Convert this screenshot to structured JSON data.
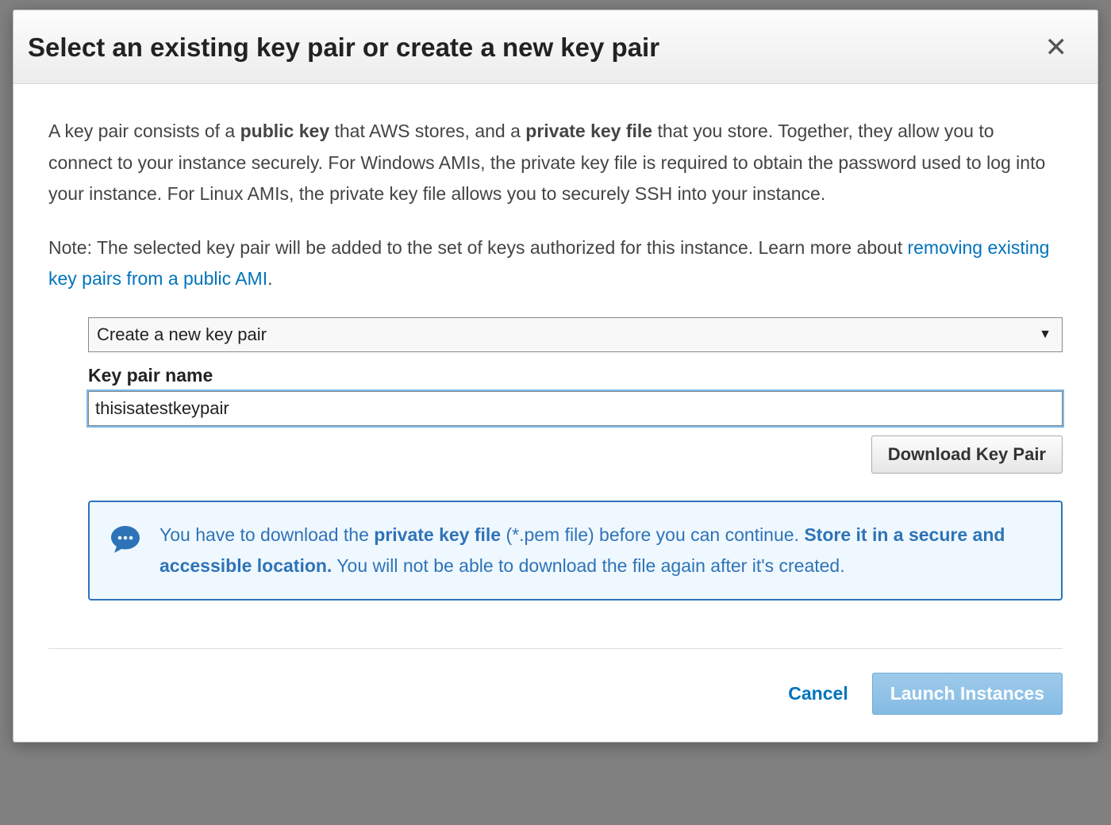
{
  "header": {
    "title": "Select an existing key pair or create a new key pair"
  },
  "body": {
    "para1_pre": "A key pair consists of a ",
    "para1_b1": "public key",
    "para1_mid1": " that AWS stores, and a ",
    "para1_b2": "private key file",
    "para1_post": " that you store. Together, they allow you to connect to your instance securely. For Windows AMIs, the private key file is required to obtain the password used to log into your instance. For Linux AMIs, the private key file allows you to securely SSH into your instance.",
    "para2_pre": "Note: The selected key pair will be added to the set of keys authorized for this instance. Learn more about ",
    "para2_link": "removing existing key pairs from a public AMI",
    "para2_post": "."
  },
  "form": {
    "select_value": "Create a new key pair",
    "field_label": "Key pair name",
    "input_value": "thisisatestkeypair",
    "download_label": "Download Key Pair"
  },
  "info": {
    "t1": "You have to download the ",
    "b1": "private key file",
    "t2": " (*.pem file) before you can continue. ",
    "b2": "Store it in a secure and accessible location.",
    "t3": " You will not be able to download the file again after it's created."
  },
  "footer": {
    "cancel": "Cancel",
    "launch": "Launch Instances"
  }
}
